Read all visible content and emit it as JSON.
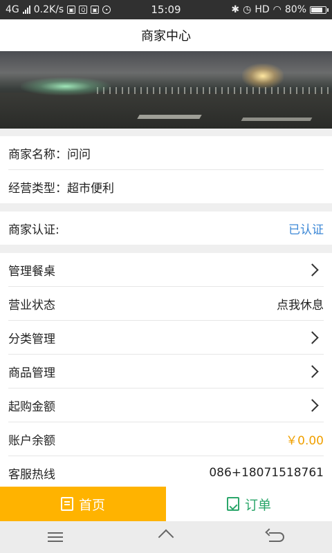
{
  "status_bar": {
    "network": "4G",
    "speed": "0.2K/s",
    "time": "15:09",
    "hd": "HD",
    "battery": "80%",
    "battery_level": 0.8
  },
  "header": {
    "title": "商家中心"
  },
  "info": [
    {
      "label": "商家名称：",
      "value": "问问"
    },
    {
      "label": "经营类型：",
      "value": "超市便利"
    }
  ],
  "certification": {
    "label": "商家认证:",
    "value": "已认证",
    "value_color": "#3b87d6"
  },
  "menu": [
    {
      "label": "管理餐桌",
      "chevron": true
    },
    {
      "label": "营业状态",
      "value": "点我休息"
    },
    {
      "label": "分类管理",
      "chevron": true
    },
    {
      "label": "商品管理",
      "chevron": true
    },
    {
      "label": "起购金额",
      "chevron": true
    },
    {
      "label": "账户余额",
      "value": "￥0.00",
      "value_color": "#f0a000"
    },
    {
      "label": "客服热线",
      "value": "086+18071518761"
    }
  ],
  "tabs": [
    {
      "label": "首页",
      "icon": "document-icon",
      "active": true,
      "color": "#ffb300"
    },
    {
      "label": "订单",
      "icon": "clipboard-check-icon",
      "active": false,
      "color": "#2aa66a"
    }
  ]
}
